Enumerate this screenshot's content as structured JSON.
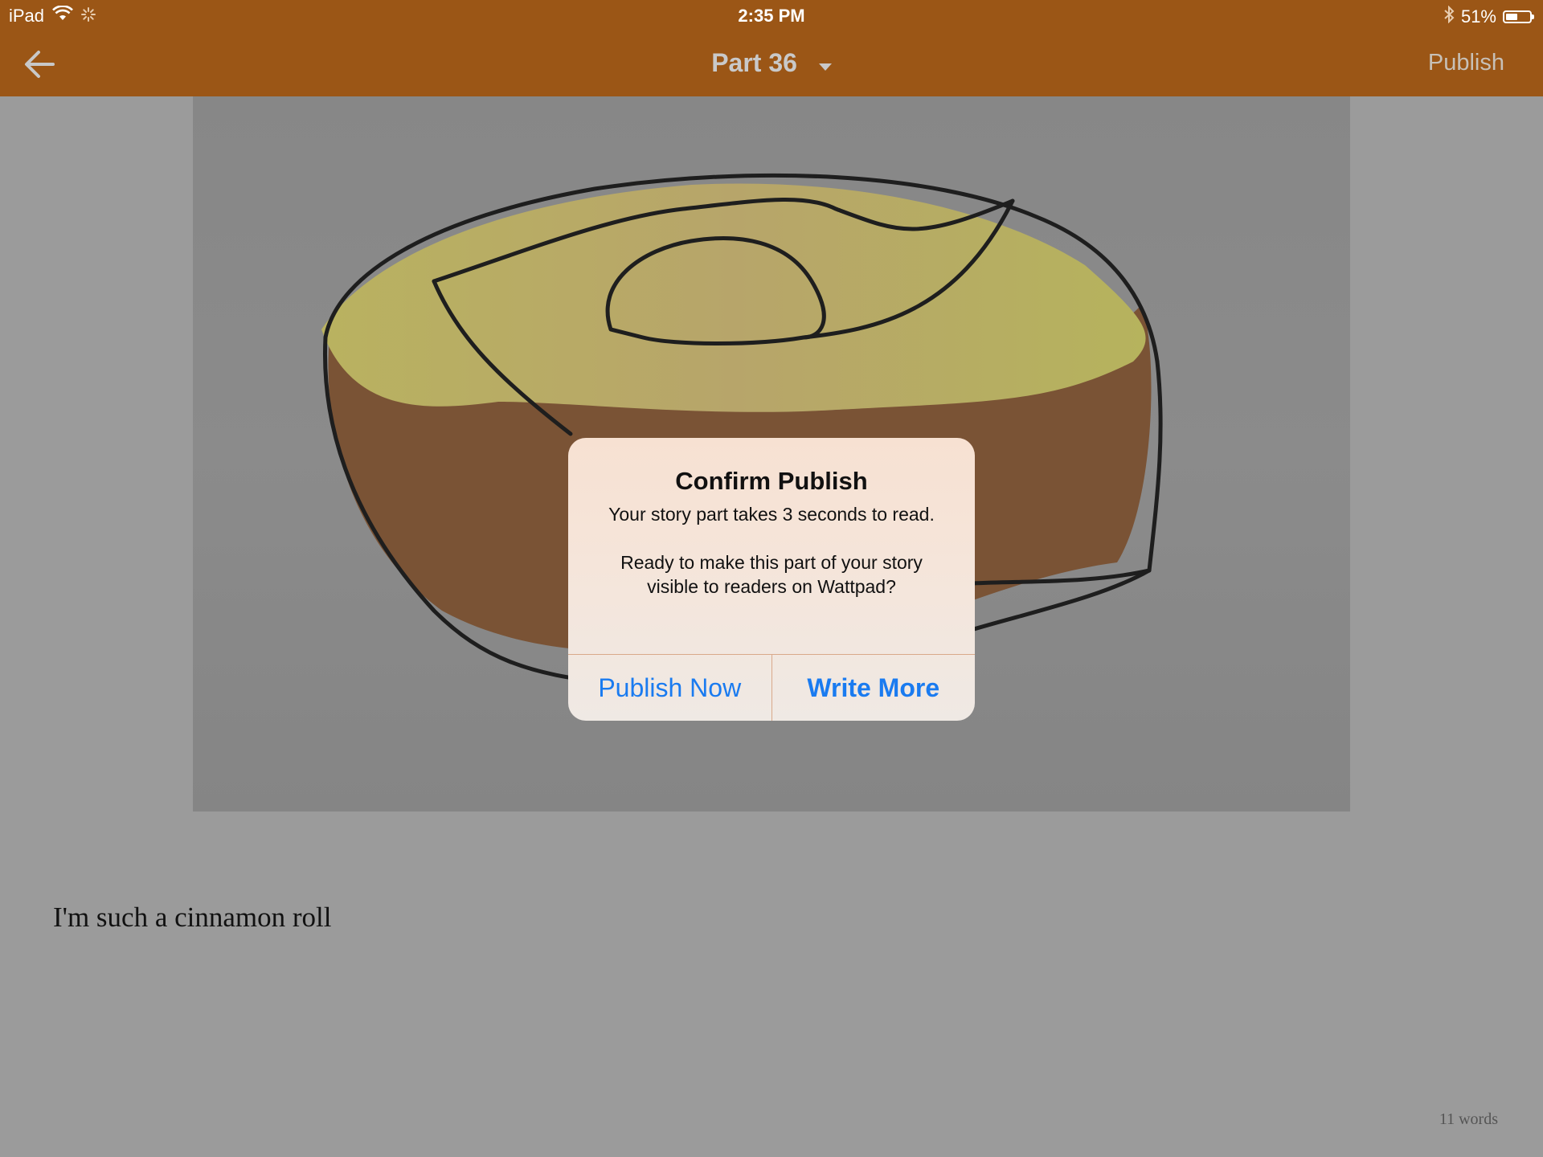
{
  "status_bar": {
    "device": "iPad",
    "time": "2:35 PM",
    "battery": "51%",
    "battery_level": 0.51
  },
  "nav": {
    "back_icon": "arrow-left-icon",
    "title": "Part 36",
    "dropdown_icon": "caret-down-icon",
    "publish_label": "Publish"
  },
  "content": {
    "image_subject": "cinnamon-roll-drawing",
    "text": "I'm such a cinnamon roll",
    "word_count": "11 words"
  },
  "alert": {
    "title": "Confirm Publish",
    "message_line1": "Your story part takes 3 seconds to read.",
    "message_line2": "Ready to make this part of your story visible to readers on Wattpad?",
    "publish_now_label": "Publish Now",
    "write_more_label": "Write More"
  },
  "colors": {
    "nav_bar": "#9b5616",
    "background": "#9b9b9b",
    "button_text": "#1a7bf0"
  }
}
